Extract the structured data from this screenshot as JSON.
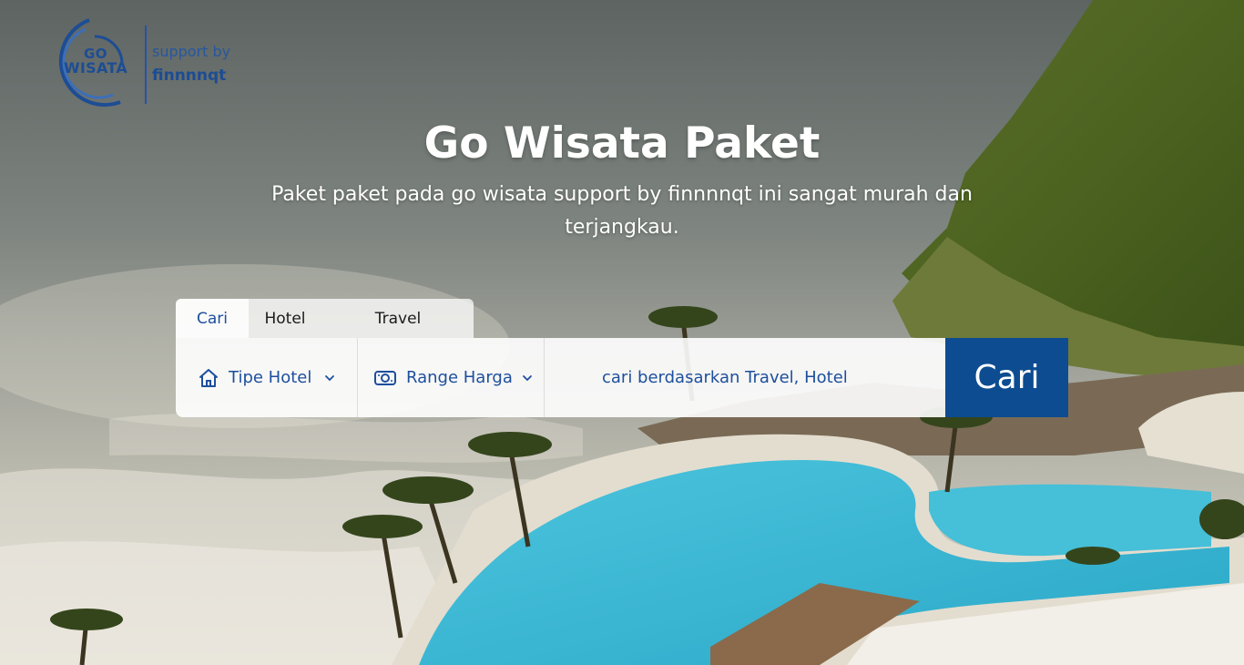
{
  "logo": {
    "line1": "GO",
    "line2": "WISATA",
    "support_text": "support by",
    "brand": "finnnnqt"
  },
  "hero": {
    "title": "Go Wisata Paket",
    "subtitle": "Paket paket pada go wisata support by finnnnqt ini sangat murah dan terjangkau."
  },
  "tabs": [
    {
      "label": "Cari",
      "active": true
    },
    {
      "label": "Hotel",
      "active": false
    },
    {
      "label": "Travel",
      "active": false
    }
  ],
  "filters": {
    "hotel_type": {
      "label": "Tipe Hotel",
      "icon": "home-icon"
    },
    "price_range": {
      "label": "Range Harga",
      "icon": "money-icon"
    }
  },
  "search": {
    "placeholder": "cari berdasarkan Travel, Hotel",
    "button_label": "Cari"
  },
  "colors": {
    "brand_blue": "#0d4c91",
    "accent_text": "#1d4f9d"
  }
}
